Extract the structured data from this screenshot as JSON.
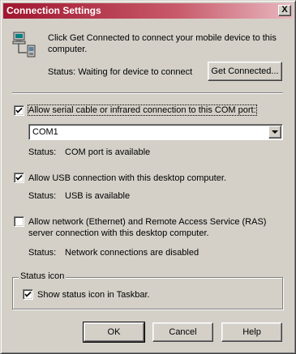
{
  "window": {
    "title": "Connection Settings",
    "close_label": "X"
  },
  "intro": {
    "line1": "Click Get Connected to connect your mobile device to this",
    "line2": "computer.",
    "status_label": "Status:",
    "status_value": "Waiting for device to connect",
    "get_connected_label": "Get Connected..."
  },
  "serial": {
    "label": "Allow serial cable or infrared connection to this COM port:",
    "checked": true,
    "port_value": "COM1",
    "status_label": "Status:",
    "status_value": "COM port is available"
  },
  "usb": {
    "label": "Allow USB connection with this desktop computer.",
    "checked": true,
    "status_label": "Status:",
    "status_value": "USB is available"
  },
  "network": {
    "label_line1": "Allow network (Ethernet) and Remote Access Service (RAS)",
    "label_line2": "server connection with this desktop computer.",
    "checked": false,
    "status_label": "Status:",
    "status_value": "Network connections are disabled"
  },
  "status_icon": {
    "group_label": "Status icon",
    "show_label": "Show status icon in Taskbar.",
    "checked": true
  },
  "buttons": {
    "ok": "OK",
    "cancel": "Cancel",
    "help": "Help"
  }
}
